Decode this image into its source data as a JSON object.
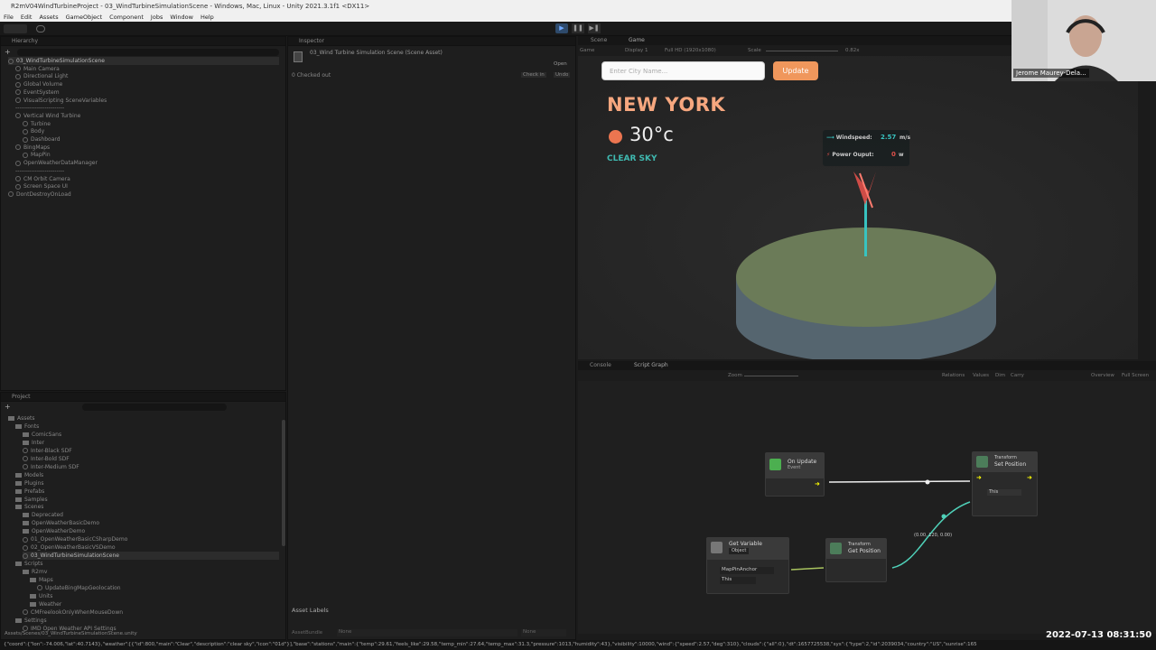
{
  "window": {
    "title": "R2mV04WindTurbineProject - 03_WindTurbineSimulationScene - Windows, Mac, Linux - Unity 2021.3.1f1 <DX11>"
  },
  "menu": [
    "File",
    "Edit",
    "Assets",
    "GameObject",
    "Component",
    "Jobs",
    "Window",
    "Help"
  ],
  "hierarchy": {
    "tab": "Hierarchy",
    "items": [
      {
        "label": "03_WindTurbineSimulationScene",
        "depth": 0,
        "kind": "scene",
        "selected": true
      },
      {
        "label": "Main Camera",
        "depth": 1,
        "kind": "go"
      },
      {
        "label": "Directional Light",
        "depth": 1,
        "kind": "go"
      },
      {
        "label": "Global Volume",
        "depth": 1,
        "kind": "go"
      },
      {
        "label": "EventSystem",
        "depth": 1,
        "kind": "go"
      },
      {
        "label": "VisualScripting SceneVariables",
        "depth": 1,
        "kind": "go"
      },
      {
        "label": "-------------------------",
        "depth": 1,
        "kind": "text"
      },
      {
        "label": "Vertical Wind Turbine",
        "depth": 1,
        "kind": "go"
      },
      {
        "label": "Turbine",
        "depth": 2,
        "kind": "go"
      },
      {
        "label": "Body",
        "depth": 2,
        "kind": "go"
      },
      {
        "label": "Dashboard",
        "depth": 2,
        "kind": "go"
      },
      {
        "label": "BingMaps",
        "depth": 1,
        "kind": "go"
      },
      {
        "label": "MapPin",
        "depth": 2,
        "kind": "go"
      },
      {
        "label": "OpenWeatherDataManager",
        "depth": 1,
        "kind": "go"
      },
      {
        "label": "-------------------------",
        "depth": 1,
        "kind": "text"
      },
      {
        "label": "CM Orbit Camera",
        "depth": 1,
        "kind": "go"
      },
      {
        "label": "Screen Space UI",
        "depth": 1,
        "kind": "go"
      },
      {
        "label": "DontDestroyOnLoad",
        "depth": 0,
        "kind": "scene"
      }
    ]
  },
  "inspector": {
    "tab": "Inspector",
    "title": "03_Wind Turbine Simulation Scene (Scene Asset)",
    "open_label": "Open",
    "checked_out": "0 Checked out",
    "check_in": "Check in",
    "undo": "Undo",
    "asset_labels": "Asset Labels",
    "asset_bundle": "AssetBundle",
    "none1": "None",
    "none2": "None"
  },
  "project": {
    "tab": "Project",
    "items": [
      {
        "label": "Assets",
        "depth": 0,
        "kind": "folder"
      },
      {
        "label": "Fonts",
        "depth": 1,
        "kind": "folder"
      },
      {
        "label": "ComicSans",
        "depth": 2,
        "kind": "folder"
      },
      {
        "label": "Inter",
        "depth": 2,
        "kind": "folder"
      },
      {
        "label": "Inter-Black SDF",
        "depth": 2,
        "kind": "file"
      },
      {
        "label": "Inter-Bold SDF",
        "depth": 2,
        "kind": "file"
      },
      {
        "label": "Inter-Medium SDF",
        "depth": 2,
        "kind": "file"
      },
      {
        "label": "Models",
        "depth": 1,
        "kind": "folder"
      },
      {
        "label": "Plugins",
        "depth": 1,
        "kind": "folder"
      },
      {
        "label": "Prefabs",
        "depth": 1,
        "kind": "folder"
      },
      {
        "label": "Samples",
        "depth": 1,
        "kind": "folder"
      },
      {
        "label": "Scenes",
        "depth": 1,
        "kind": "folder"
      },
      {
        "label": "Deprecated",
        "depth": 2,
        "kind": "folder"
      },
      {
        "label": "OpenWeatherBasicDemo",
        "depth": 2,
        "kind": "folder"
      },
      {
        "label": "OpenWeatherDemo",
        "depth": 2,
        "kind": "folder"
      },
      {
        "label": "01_OpenWeatherBasicCSharpDemo",
        "depth": 2,
        "kind": "file"
      },
      {
        "label": "02_OpenWeatherBasicVSDemo",
        "depth": 2,
        "kind": "file"
      },
      {
        "label": "03_WindTurbineSimulationScene",
        "depth": 2,
        "kind": "file",
        "selected": true
      },
      {
        "label": "Scripts",
        "depth": 1,
        "kind": "folder"
      },
      {
        "label": "R2mv",
        "depth": 2,
        "kind": "folder"
      },
      {
        "label": "Maps",
        "depth": 3,
        "kind": "folder"
      },
      {
        "label": "UpdateBingMapGeolocation",
        "depth": 4,
        "kind": "file"
      },
      {
        "label": "Units",
        "depth": 3,
        "kind": "folder"
      },
      {
        "label": "Weather",
        "depth": 3,
        "kind": "folder"
      },
      {
        "label": "CMFreelookOnlyWhenMouseDown",
        "depth": 2,
        "kind": "file"
      },
      {
        "label": "Settings",
        "depth": 1,
        "kind": "folder"
      },
      {
        "label": "IMD Open Weather API Settings",
        "depth": 2,
        "kind": "file"
      }
    ],
    "path": "Assets/Scenes/03_WindTurbineSimulationScene.unity"
  },
  "scene_tabs": {
    "scene": "Scene",
    "game": "Game"
  },
  "game_toolbar": {
    "mode": "Game",
    "display": "Display 1",
    "resolution": "Full HD (1920x1080)",
    "scale_label": "Scale",
    "scale_value": "0.82x"
  },
  "game": {
    "input_placeholder": "Enter City Name...",
    "update_label": "Update",
    "city": "NEW YORK",
    "temperature": "30°c",
    "condition": "CLEAR SKY",
    "windspeed_label": "Windspeed:",
    "windspeed_value": "2.57",
    "windspeed_unit": "m/s",
    "power_label": "Power Ouput:",
    "power_value": "0",
    "power_unit": "w",
    "colors": {
      "city": "#f6a77f",
      "temp_dot": "#ec7550",
      "condition": "#3fb9b0",
      "update": "#f0975c"
    }
  },
  "bottom_tabs": {
    "console": "Console",
    "graph": "Script Graph"
  },
  "graph_toolbar": {
    "relations": "Relations",
    "values": "Values",
    "dim": "Dim",
    "carry": "Carry",
    "overview": "Overview",
    "fullscreen": "Full Screen",
    "zoom": "Zoom"
  },
  "nodes": {
    "on_update": {
      "title": "On Update",
      "subtitle": "Event"
    },
    "set_position": {
      "title": "Transform",
      "subtitle": "Set Position",
      "port": "This"
    },
    "get_variable": {
      "title": "Get Variable",
      "kind": "Object",
      "name": "MapPinAnchor",
      "port": "This"
    },
    "get_position": {
      "title": "Transform",
      "subtitle": "Get Position"
    },
    "wire_label": "(0.00, 120, 0.00)"
  },
  "webcam": {
    "name": "Jerome Maurey-Dela..."
  },
  "status": "{\"coord\":{\"lon\":-74.006,\"lat\":40.7143},\"weather\":[{\"id\":800,\"main\":\"Clear\",\"description\":\"clear sky\",\"icon\":\"01d\"}],\"base\":\"stations\",\"main\":{\"temp\":29.61,\"feels_like\":29.58,\"temp_min\":27.64,\"temp_max\":31.3,\"pressure\":1013,\"humidity\":43},\"visibility\":10000,\"wind\":{\"speed\":2.57,\"deg\":310},\"clouds\":{\"all\":0},\"dt\":1657725538,\"sys\":{\"type\":2,\"id\":2039034,\"country\":\"US\",\"sunrise\":165",
  "clock": "2022-07-13  08:31:50"
}
